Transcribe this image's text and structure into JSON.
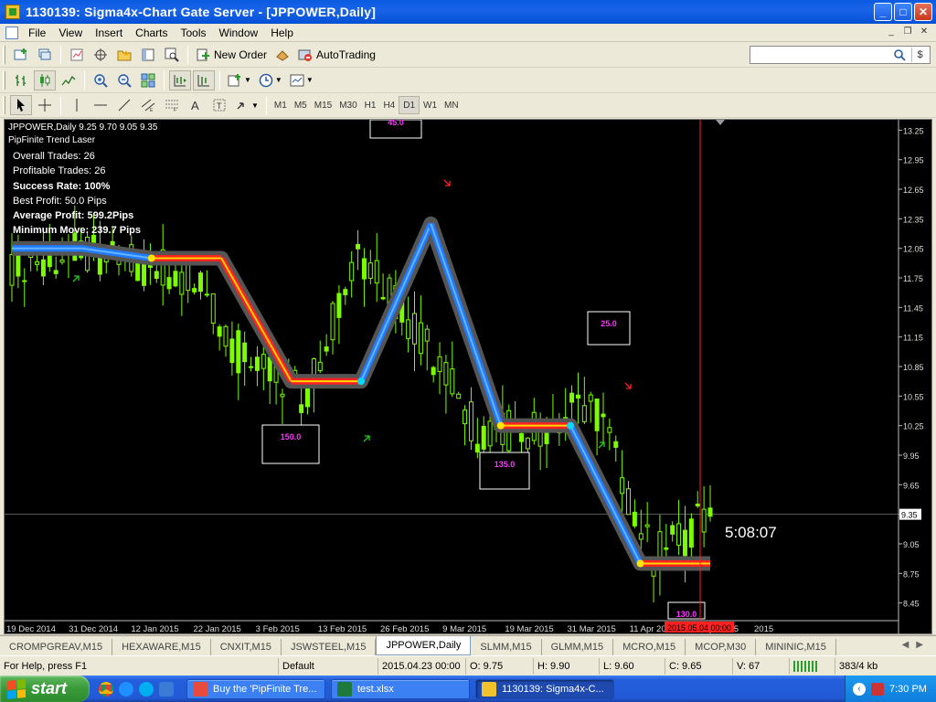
{
  "window": {
    "title": "1130139: Sigma4x-Chart Gate Server - [JPPOWER,Daily]",
    "minimize": "_",
    "maximize": "□",
    "close": "✕"
  },
  "menu": [
    "File",
    "View",
    "Insert",
    "Charts",
    "Tools",
    "Window",
    "Help"
  ],
  "toolbar": {
    "new_order": "New Order",
    "autotrading": "AutoTrading",
    "search_placeholder": "",
    "search_icon": "search-icon",
    "signals_icon": "$"
  },
  "timeframes": [
    "M1",
    "M5",
    "M15",
    "M30",
    "H1",
    "H4",
    "D1",
    "W1",
    "MN"
  ],
  "active_timeframe": "D1",
  "chart": {
    "header": "JPPOWER,Daily  9.25 9.70 9.05 9.35",
    "indicator_name": "PipFinite Trend Laser",
    "stats": [
      {
        "text": "Overall Trades: 26",
        "bold": false
      },
      {
        "text": "Profitable Trades: 26",
        "bold": false
      },
      {
        "text": "Success Rate: 100%",
        "bold": true
      },
      {
        "text": "Best Profit: 50.0 Pips",
        "bold": false
      },
      {
        "text": "Average Profit: 599.2Pips",
        "bold": true
      },
      {
        "text": "Minimum Move: 239.7 Pips",
        "bold": true
      }
    ],
    "countdown": "5:08:07",
    "current_price": "9.35",
    "vline_date_label": "2015.05.04 00:00",
    "price_labels": [
      "13.25",
      "12.95",
      "12.65",
      "12.35",
      "12.05",
      "11.75",
      "11.45",
      "11.15",
      "10.85",
      "10.55",
      "10.25",
      "9.95",
      "9.65",
      "9.35",
      "9.05",
      "8.75",
      "8.45"
    ],
    "date_labels": [
      "19 Dec 2014",
      "31 Dec 2014",
      "12 Jan 2015",
      "22 Jan 2015",
      "3 Feb 2015",
      "13 Feb 2015",
      "26 Feb 2015",
      "9 Mar 2015",
      "19 Mar 2015",
      "31 Mar 2015",
      "11 Apr 2015",
      "23 Apr 2015",
      "2015"
    ],
    "boxes": [
      {
        "label": "45.0",
        "color": "#ff33ff"
      },
      {
        "label": "150.0",
        "color": "#ff33ff"
      },
      {
        "label": "25.0",
        "color": "#ff33ff"
      },
      {
        "label": "135.0",
        "color": "#ff33ff"
      },
      {
        "label": "130.0",
        "color": "#ff33ff"
      }
    ],
    "colors": {
      "bull_candle": "#7CFC00",
      "laser_outer": "#555555",
      "laser_red": "#ff2020",
      "laser_yellow": "#ffd700",
      "laser_blue": "#1f7bff",
      "dot_cyan": "#00d8ff",
      "dot_yellow": "#ffe600",
      "arrow_up": "#22cc22",
      "arrow_down": "#ff2020",
      "vline": "#ff2020"
    }
  },
  "chart_data": {
    "type": "candlestick",
    "title": "JPPOWER,Daily",
    "ylim": [
      8.4,
      13.3
    ],
    "x": [
      "19 Dec 2014",
      "31 Dec 2014",
      "12 Jan 2015",
      "22 Jan 2015",
      "3 Feb 2015",
      "13 Feb 2015",
      "26 Feb 2015",
      "9 Mar 2015",
      "19 Mar 2015",
      "31 Mar 2015",
      "11 Apr 2015",
      "23 Apr 2015",
      "2015"
    ],
    "close": [
      11.9,
      12.0,
      11.9,
      11.8,
      10.9,
      10.55,
      12.0,
      11.2,
      10.2,
      10.2,
      10.5,
      8.9,
      9.35
    ],
    "laser": [
      {
        "x": "19 Dec 2014",
        "y": 12.05,
        "trend": "up"
      },
      {
        "x": "31 Dec 2014",
        "y": 12.05,
        "trend": "up"
      },
      {
        "x": "12 Jan 2015",
        "y": 11.95,
        "trend": "down"
      },
      {
        "x": "3 Feb 2015",
        "y": 11.95,
        "trend": "down"
      },
      {
        "x": "13 Feb 2015",
        "y": 10.7,
        "trend": "down"
      },
      {
        "x": "26 Feb 2015",
        "y": 10.7,
        "trend": "up"
      },
      {
        "x": "9 Mar 2015",
        "y": 12.3,
        "trend": "up"
      },
      {
        "x": "19 Mar 2015",
        "y": 10.25,
        "trend": "down"
      },
      {
        "x": "11 Apr 2015",
        "y": 10.25,
        "trend": "up"
      },
      {
        "x": "23 Apr 2015",
        "y": 8.85,
        "trend": "down"
      },
      {
        "x": "2015",
        "y": 8.85,
        "trend": "down"
      }
    ],
    "annotations": [
      "45.0",
      "150.0",
      "25.0",
      "135.0",
      "130.0"
    ]
  },
  "tabs": [
    {
      "label": "CROMPGREAV,M15"
    },
    {
      "label": "HEXAWARE,M15"
    },
    {
      "label": "CNXIT,M15"
    },
    {
      "label": "JSWSTEEL,M15"
    },
    {
      "label": "JPPOWER,Daily",
      "active": true
    },
    {
      "label": "SLMM,M15"
    },
    {
      "label": "GLMM,M15"
    },
    {
      "label": "MCRO,M15"
    },
    {
      "label": "MCOP,M30"
    },
    {
      "label": "MININIC,M15"
    }
  ],
  "status": {
    "help": "For Help, press F1",
    "profile": "Default",
    "time": "2015.04.23 00:00",
    "open": "O: 9.75",
    "high": "H: 9.90",
    "low": "L: 9.60",
    "close": "C: 9.65",
    "volume": "V: 67",
    "traffic": "383/4 kb"
  },
  "taskbar": {
    "start": "start",
    "tasks": [
      {
        "label": "Buy the 'PipFinite Tre...",
        "icon_color": "#e84b3c"
      },
      {
        "label": "test.xlsx",
        "icon_color": "#1e7a3a"
      },
      {
        "label": "1130139: Sigma4x-C...",
        "icon_color": "#f2c12e",
        "active": true
      }
    ],
    "clock": "7:30 PM"
  }
}
